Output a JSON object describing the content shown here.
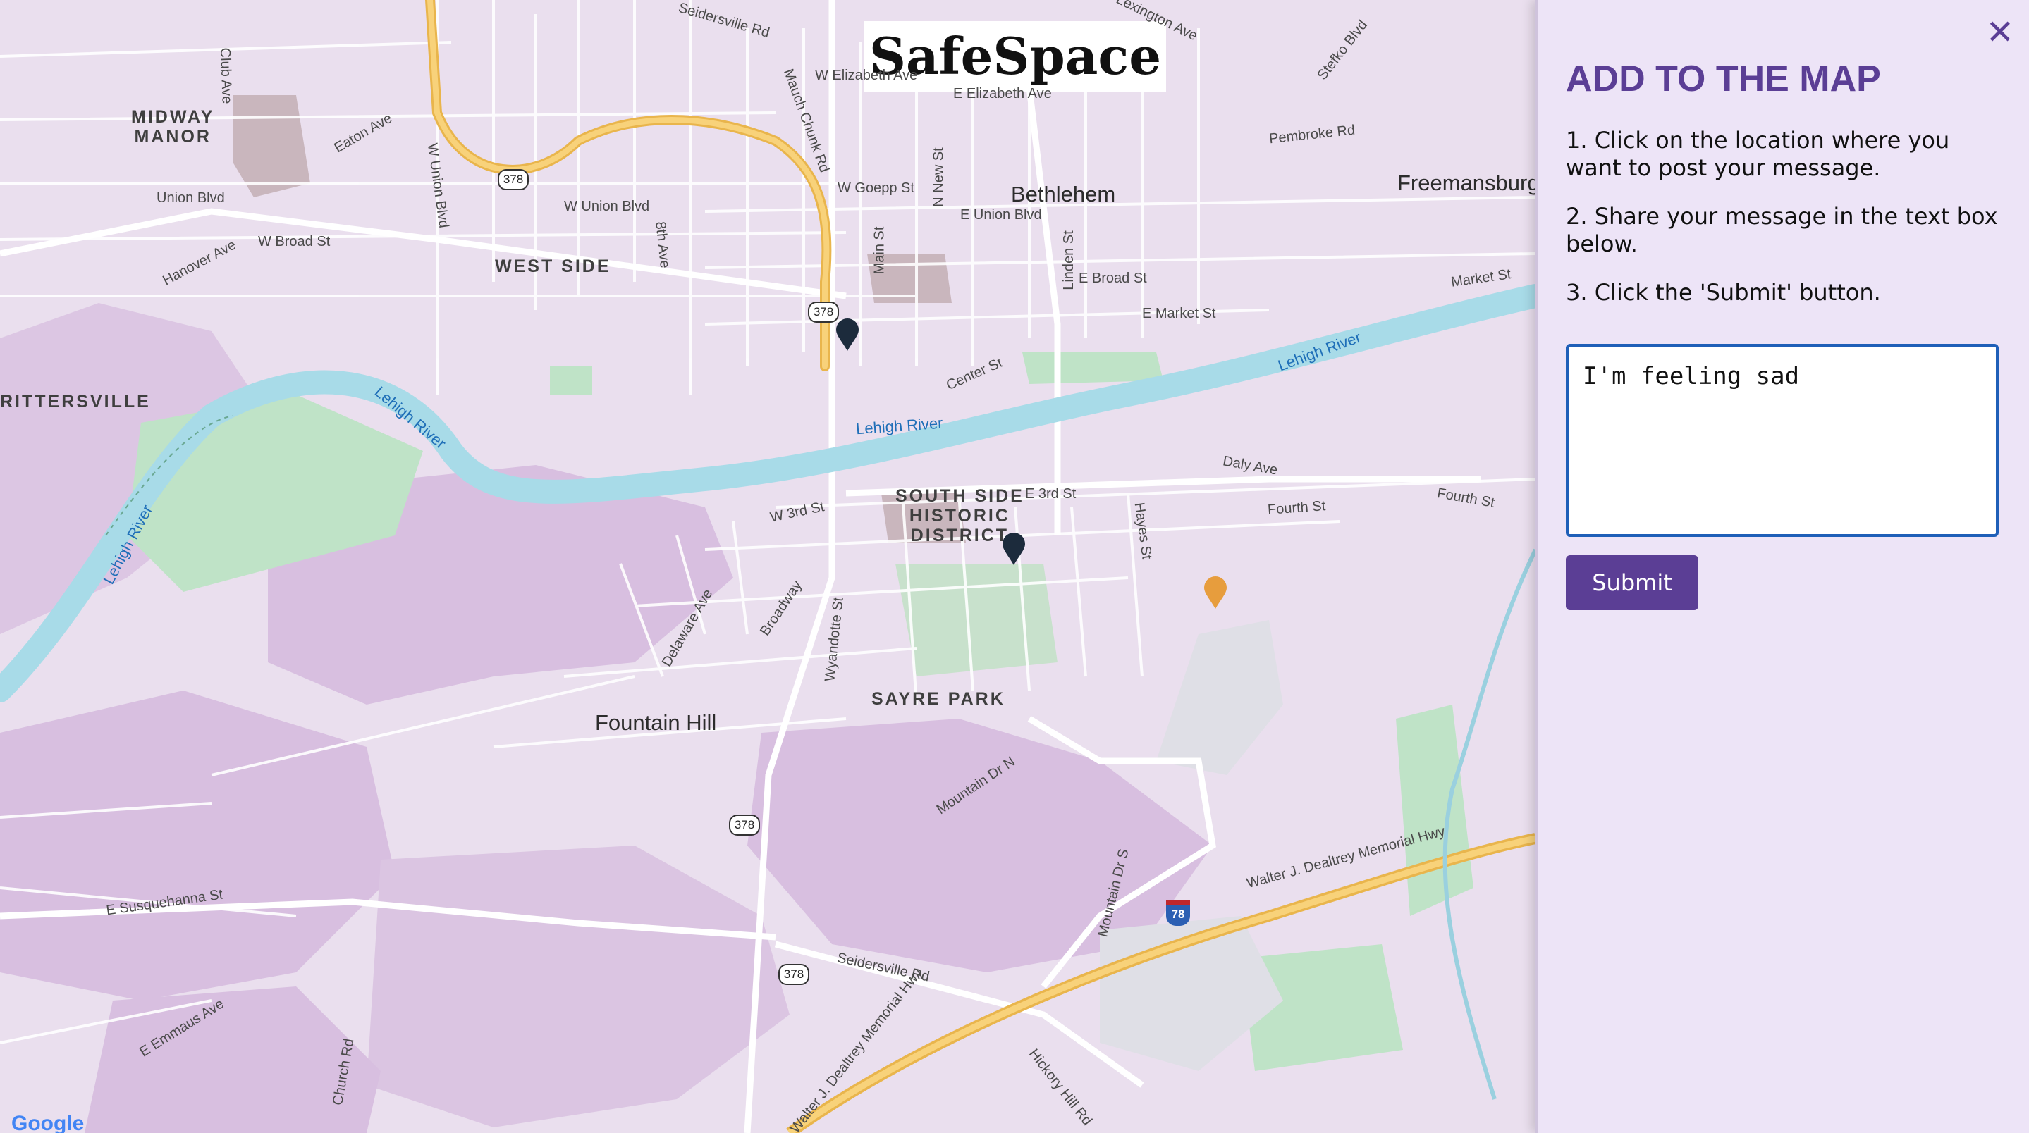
{
  "brand": {
    "title": "SafeSpace"
  },
  "map": {
    "attribution": "Google",
    "labels": {
      "city_bethlehem": "Bethlehem",
      "city_freemansburg": "Freemansburg",
      "city_fountain_hill": "Fountain Hill",
      "district_midway": "MIDWAY\nMANOR",
      "district_west_side": "WEST SIDE",
      "district_rittersville": "RITTERSVILLE",
      "district_south_side": "SOUTH SIDE\nHISTORIC\nDISTRICT",
      "district_sayre_park": "SAYRE PARK",
      "river_1": "Lehigh River",
      "river_2": "Lehigh River",
      "river_3": "Lehigh River",
      "river_4": "Lehigh River",
      "st_club_ave": "Club Ave",
      "st_eaton_ave": "Eaton Ave",
      "st_union_blvd": "Union Blvd",
      "st_w_union_blvd_1": "W Union Blvd",
      "st_w_union_blvd_2": "W Union Blvd",
      "st_w_broad_st": "W Broad St",
      "st_hanover_ave": "Hanover Ave",
      "st_8th_ave": "8th Ave",
      "st_mauch_chunk": "Mauch Chunk Rd",
      "st_w_elizabeth": "W Elizabeth Ave",
      "st_e_elizabeth": "E Elizabeth Ave",
      "st_w_goepp": "W Goepp St",
      "st_n_new": "N New St",
      "st_e_union": "E Union Blvd",
      "st_main": "Main St",
      "st_linden": "Linden St",
      "st_e_broad": "E Broad St",
      "st_e_market": "E Market St",
      "st_market": "Market St",
      "st_pembroke": "Pembroke Rd",
      "st_stefko": "Stefko Blvd",
      "st_center": "Center St",
      "st_daly": "Daly Ave",
      "st_fourth": "Fourth St",
      "st_fourth_2": "Fourth St",
      "st_w_3rd": "W 3rd St",
      "st_e_3rd": "E 3rd St",
      "st_hayes": "Hayes St",
      "st_delaware": "Delaware Ave",
      "st_broadway": "Broadway",
      "st_wyandotte": "Wyandotte St",
      "st_mountain_dr_n": "Mountain Dr N",
      "st_mountain_dr_s": "Mountain Dr S",
      "st_dealtrey_1": "Walter J. Dealtrey Memorial Hwy",
      "st_dealtrey_2": "Walter J. Dealtrey Memorial Hwy",
      "st_e_susquehanna": "E Susquehanna St",
      "st_seidersville": "Seidersville Rd",
      "st_e_emmaus": "E Emmaus Ave",
      "st_church": "Church Rd",
      "st_hickory_hill": "Hickory Hill Rd",
      "st_seidersville_top": "Seidersville Rd",
      "st_lexington": "Lexington Ave"
    },
    "shields": {
      "route_378": "378",
      "interstate_78": "78"
    },
    "pins": [
      {
        "name": "map-pin-dark-1",
        "color": "#1c2b3c"
      },
      {
        "name": "map-pin-dark-2",
        "color": "#1c2b3c"
      },
      {
        "name": "map-pin-orange",
        "color": "#e79d3d"
      }
    ]
  },
  "panel": {
    "close_label": "✕",
    "title": "ADD TO THE MAP",
    "step1": "1. Click on the location where you want to post your message.",
    "step2": "2. Share your message in the text box below.",
    "step3": "3. Click the 'Submit' button.",
    "message_value": "I'm feeling sad",
    "submit_label": "Submit"
  },
  "colors": {
    "accent": "#5b3e95",
    "input_border": "#1f5fb8",
    "river": "#a8dbe8",
    "highway": "#f3c25a"
  }
}
